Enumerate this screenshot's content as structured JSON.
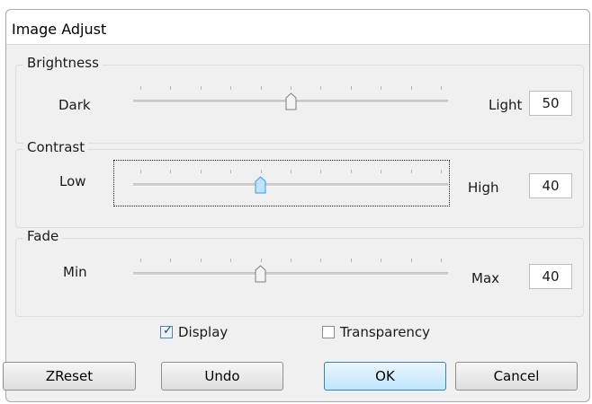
{
  "window": {
    "title": "Image Adjust"
  },
  "brightness": {
    "group_title": "Brightness",
    "min_label": "Dark",
    "max_label": "Light",
    "value": "50",
    "level_percent": 50
  },
  "contrast": {
    "group_title": "Contrast",
    "min_label": "Low",
    "max_label": "High",
    "value": "40",
    "level_percent": 40
  },
  "fade": {
    "group_title": "Fade",
    "min_label": "Min",
    "max_label": "Max",
    "value": "40",
    "level_percent": 40
  },
  "options": {
    "display_label": "Display",
    "display_checked": true,
    "transparency_label": "Transparency",
    "transparency_checked": false
  },
  "buttons": {
    "zreset": "ZReset",
    "undo": "Undo",
    "ok": "OK",
    "cancel": "Cancel"
  },
  "colors": {
    "dialog_bg": "#f0f0f0",
    "focused_thumb": "#3a9be0",
    "default_button_border": "#3c7fb1"
  }
}
